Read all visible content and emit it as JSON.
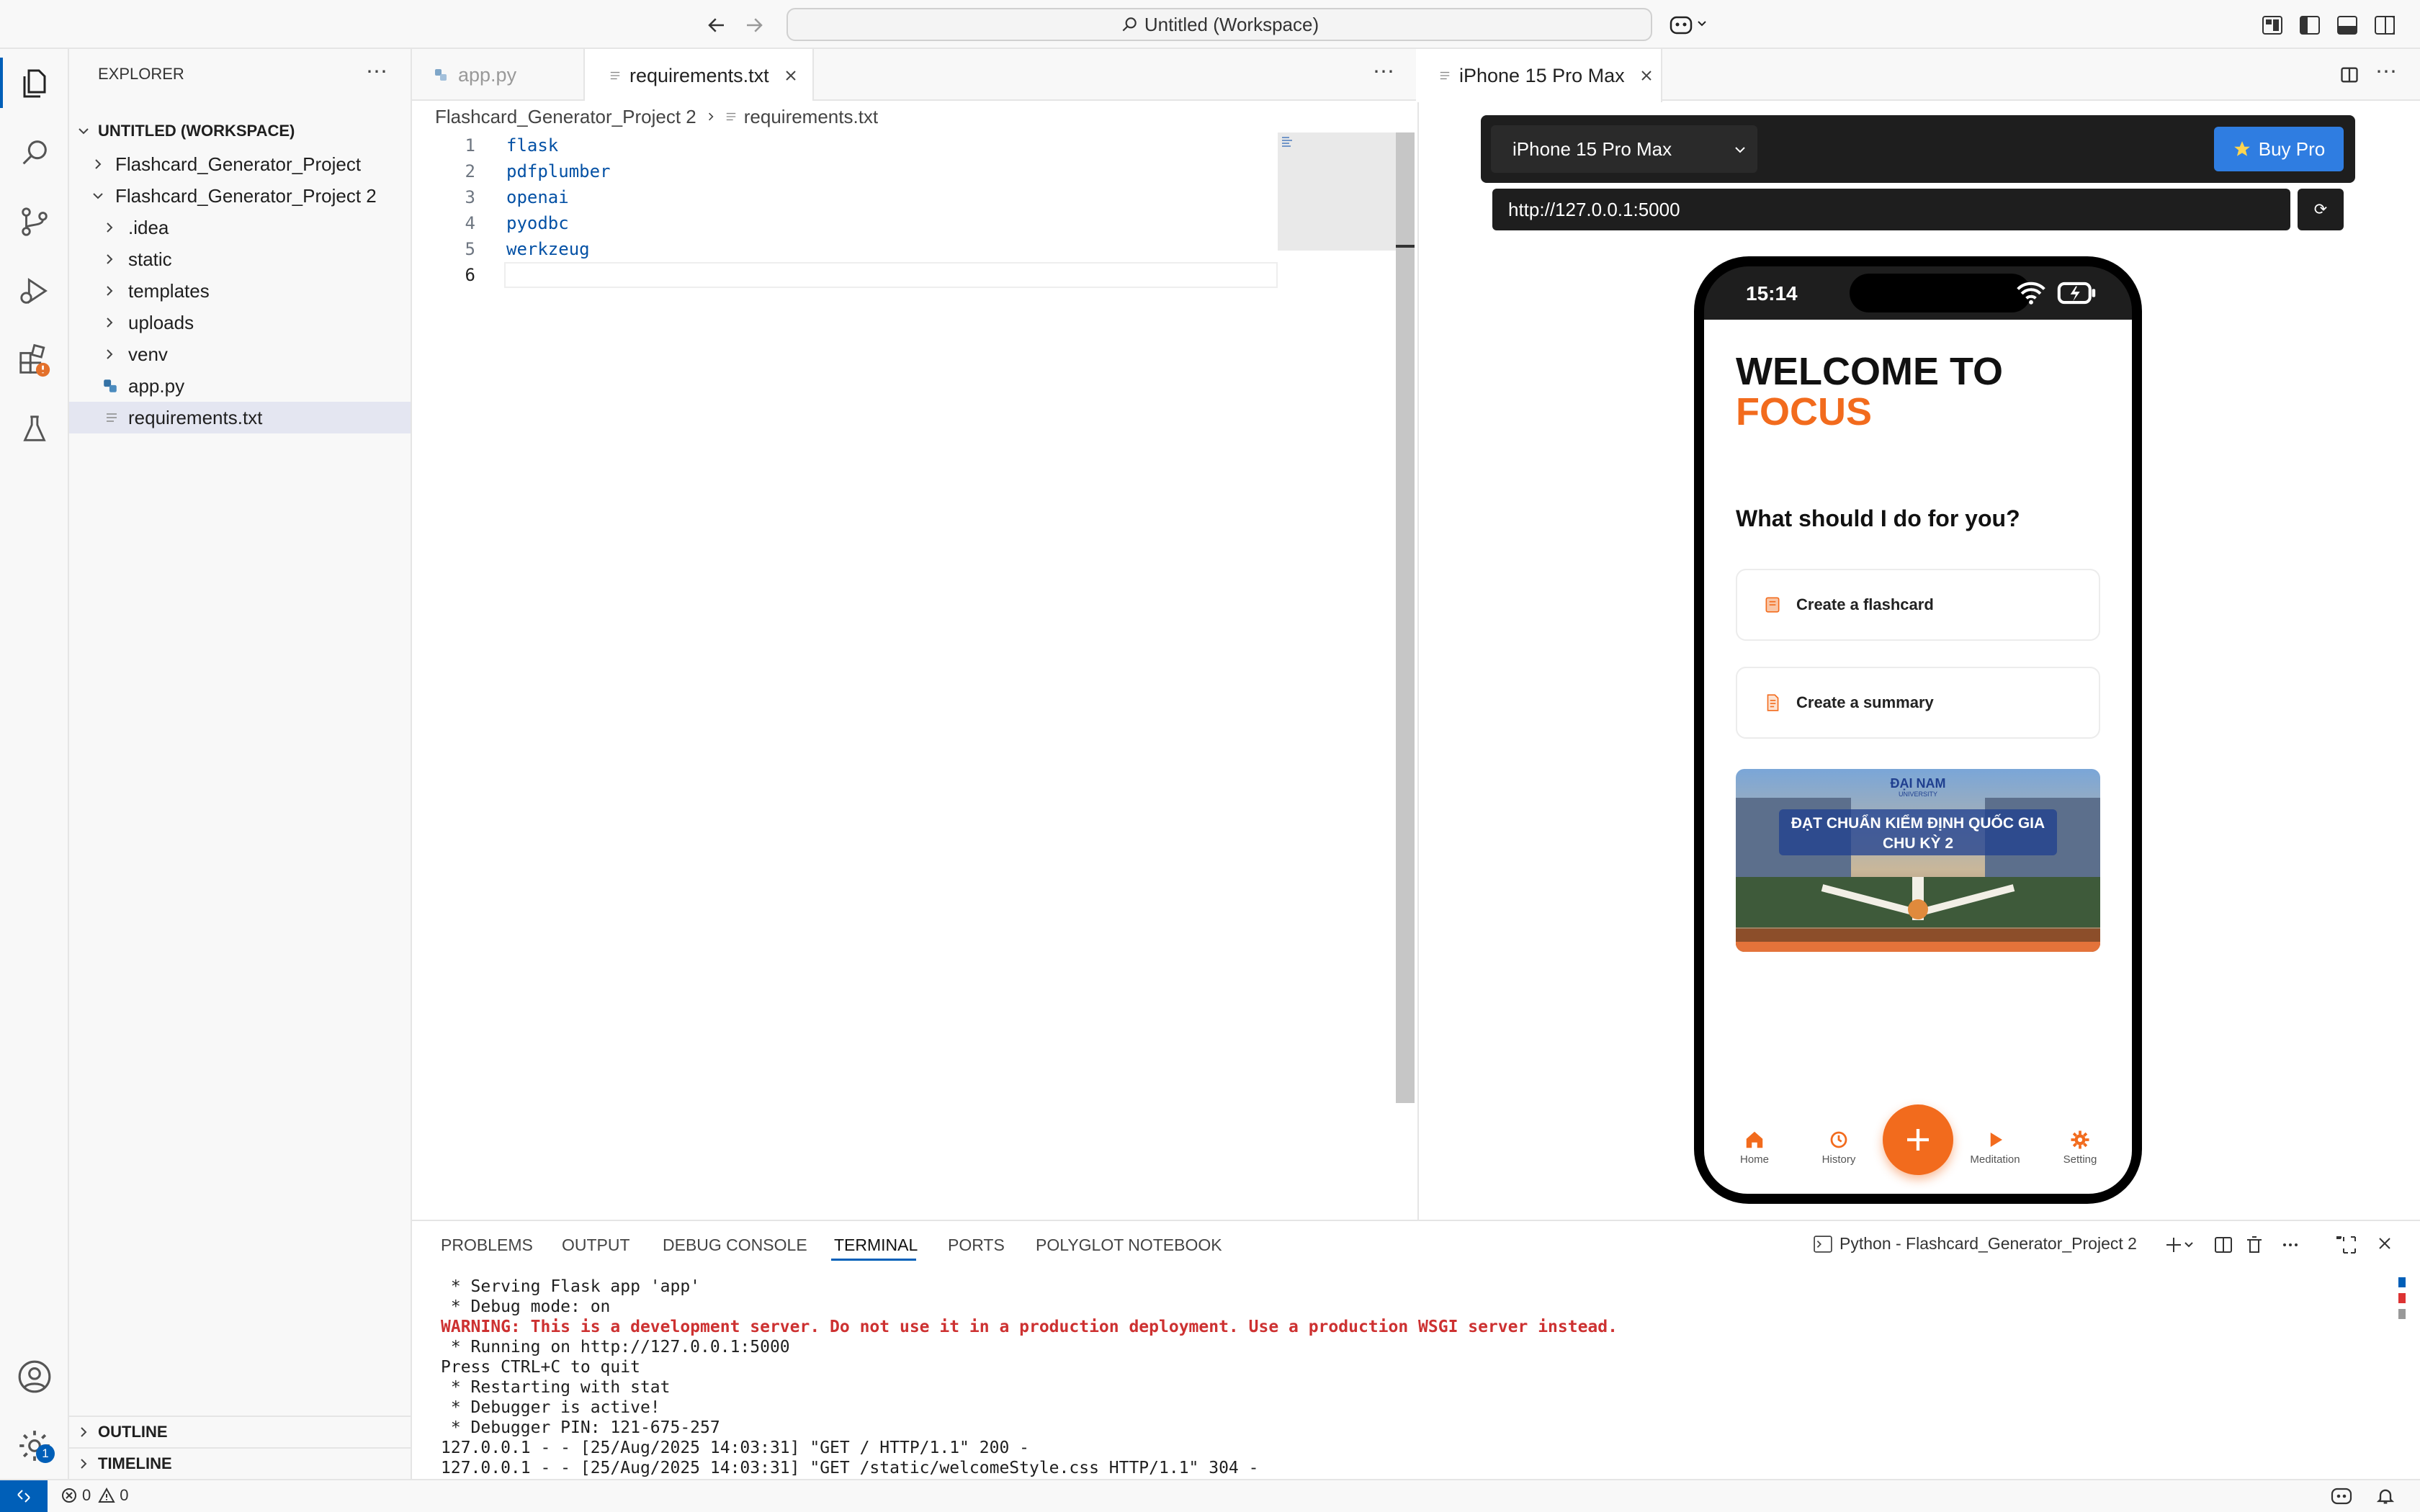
{
  "window": {
    "title": "Untitled (Workspace)"
  },
  "sidebar": {
    "title": "EXPLORER",
    "workspace": "UNTITLED (WORKSPACE)",
    "items": [
      {
        "label": "Flashcard_Generator_Project"
      },
      {
        "label": "Flashcard_Generator_Project 2"
      },
      {
        "label": ".idea"
      },
      {
        "label": "static"
      },
      {
        "label": "templates"
      },
      {
        "label": "uploads"
      },
      {
        "label": "venv"
      },
      {
        "label": "app.py"
      },
      {
        "label": "requirements.txt"
      }
    ],
    "outline": "OUTLINE",
    "timeline": "TIMELINE",
    "settings_badge": "1"
  },
  "editor": {
    "tabs": [
      {
        "label": "app.py"
      },
      {
        "label": "requirements.txt"
      }
    ],
    "breadcrumb": {
      "folder": "Flashcard_Generator_Project 2",
      "file": "requirements.txt"
    },
    "lines": [
      {
        "num": "1",
        "text": "flask"
      },
      {
        "num": "2",
        "text": "pdfplumber"
      },
      {
        "num": "3",
        "text": "openai"
      },
      {
        "num": "4",
        "text": "pyodbc"
      },
      {
        "num": "5",
        "text": "werkzeug"
      },
      {
        "num": "6",
        "text": ""
      }
    ]
  },
  "preview": {
    "tab": "iPhone 15 Pro Max",
    "device": "iPhone 15 Pro Max",
    "buy_pro": "Buy Pro",
    "url": "http://127.0.0.1:5000",
    "refresh": "⟳",
    "phone": {
      "time": "15:14",
      "welcome": "WELCOME TO",
      "brand": "FOCUS",
      "question": "What should I do for you?",
      "cards": [
        {
          "label": "Create a flashcard"
        },
        {
          "label": "Create a summary"
        }
      ],
      "banner": {
        "logo": "ĐẠI NAM",
        "logo_sub": "UNIVERSITY",
        "line1": "ĐẠT CHUẨN KIỂM ĐỊNH QUỐC GIA",
        "line2": "CHU KỲ 2"
      },
      "nav": [
        {
          "label": "Home"
        },
        {
          "label": "History"
        },
        {
          "label": "Meditation"
        },
        {
          "label": "Setting"
        }
      ],
      "accent": "#f26b1d"
    }
  },
  "panel": {
    "tabs": [
      {
        "label": "PROBLEMS"
      },
      {
        "label": "OUTPUT"
      },
      {
        "label": "DEBUG CONSOLE"
      },
      {
        "label": "TERMINAL"
      },
      {
        "label": "PORTS"
      },
      {
        "label": "POLYGLOT NOTEBOOK"
      }
    ],
    "terminal_name": "Python - Flashcard_Generator_Project 2",
    "lines": [
      {
        "text": " * Serving Flask app 'app'"
      },
      {
        "text": " * Debug mode: on"
      },
      {
        "text": "WARNING: This is a development server. Do not use it in a production deployment. Use a production WSGI server instead."
      },
      {
        "text": " * Running on http://127.0.0.1:5000"
      },
      {
        "text": "Press CTRL+C to quit"
      },
      {
        "text": " * Restarting with stat"
      },
      {
        "text": " * Debugger is active!"
      },
      {
        "text": " * Debugger PIN: 121-675-257"
      },
      {
        "text": "127.0.0.1 - - [25/Aug/2025 14:03:31] \"GET / HTTP/1.1\" 200 -"
      },
      {
        "text": "127.0.0.1 - - [25/Aug/2025 14:03:31] \"GET /static/welcomeStyle.css HTTP/1.1\" 304 -"
      }
    ]
  },
  "statusbar": {
    "errors": "0",
    "warnings": "0"
  }
}
